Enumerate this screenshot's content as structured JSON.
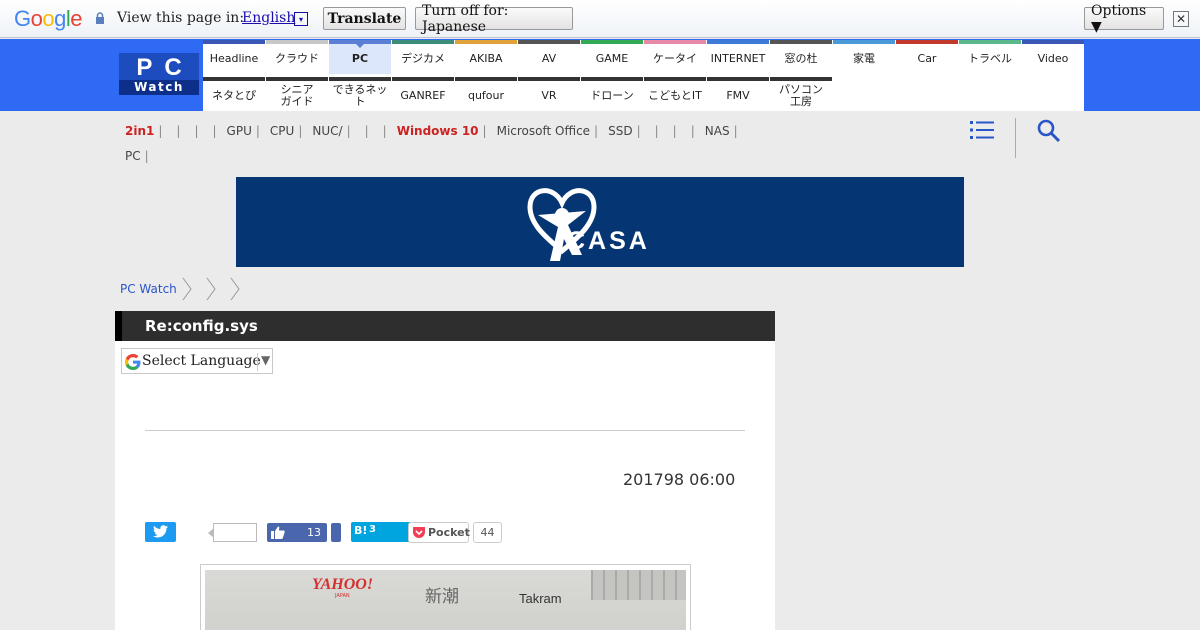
{
  "translate_bar": {
    "logo": "Google",
    "view_text": "View this page in:",
    "language": "English",
    "lang_arrow": "▾",
    "translate_label": "Translate",
    "turn_off_label": "Turn off for: Japanese",
    "options_label": "Options ▼",
    "close_glyph": "✕"
  },
  "header": {
    "logo_pc": "PC",
    "logo_watch": "Watch",
    "nav_row1": [
      "Headline",
      "クラウド",
      "PC",
      "デジカメ",
      "AKIBA",
      "AV",
      "GAME",
      "ケータイ",
      "INTERNET",
      "窓の杜",
      "家電",
      "Car",
      "トラベル",
      "Video"
    ],
    "nav_row2": [
      "ネタとぴ",
      "シニアガイド",
      "できるネット",
      "GANREF",
      "qufour",
      "VR",
      "ドローン",
      "こどもとIT",
      "FMV",
      "パソコン工房"
    ],
    "nav_row1_colors": [
      "#3a57b5",
      "#c7c7c7",
      "#5b7fd4",
      "#3b8d7a",
      "#e2a23a",
      "#555555",
      "#33aa55",
      "#e68aa8",
      "#3e7bd6",
      "#555555",
      "#4a9ad8",
      "#c0392b",
      "#5cb88b",
      "#3a57b5"
    ]
  },
  "tags": {
    "items": [
      "2in1",
      "",
      "",
      "",
      "GPU",
      "CPU",
      "NUC/",
      "",
      "",
      "Windows 10",
      "Microsoft Office",
      "SSD",
      "",
      "",
      "",
      "NAS",
      "PC"
    ],
    "red": [
      "2in1",
      "Windows 10"
    ],
    "separator": "|"
  },
  "banner": {
    "brand": "CASA"
  },
  "breadcrumb": {
    "home": "PC Watch"
  },
  "article": {
    "title": "Re:config.sys",
    "select_language": "Select Language",
    "select_arrow": "▼",
    "date": "201798 06:00"
  },
  "social": {
    "facebook_count": "13",
    "hatena_label": "B!",
    "hatena_count": "3",
    "pocket_label": "Pocket",
    "pocket_count": "44"
  },
  "photo": {
    "sign_yahoo": "YAHOO!",
    "sign_japan": "JAPAN",
    "sign_shincho": "新潮",
    "sign_takram": "Takram"
  }
}
